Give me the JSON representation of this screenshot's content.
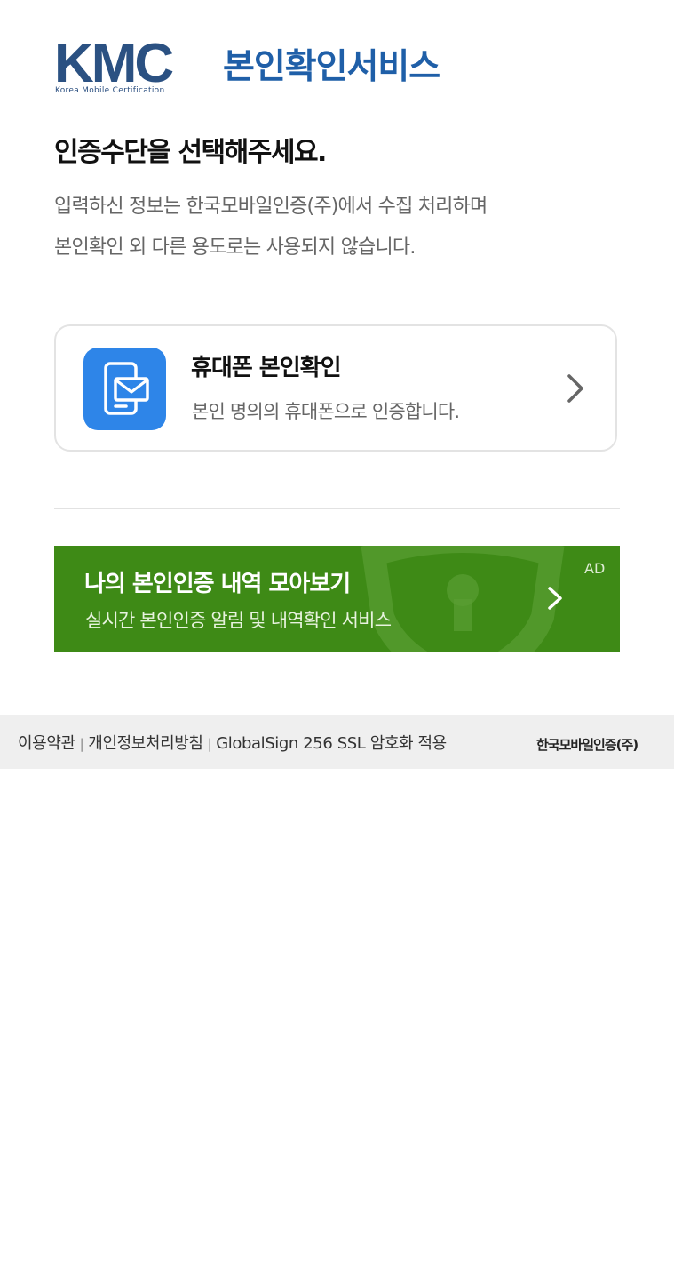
{
  "header": {
    "logo_text": "KMC",
    "logo_subtitle": "Korea Mobile Certification",
    "service_title": "본인확인서비스"
  },
  "intro": {
    "heading": "인증수단을 선택해주세요.",
    "description_lines": [
      "입력하신 정보는 한국모바일인증(주)에서 수집 처리하며",
      "본인확인 외 다른 용도로는 사용되지 않습니다."
    ]
  },
  "option": {
    "title": "휴대폰 본인확인",
    "description": "본인 명의의 휴대폰으로 인증합니다.",
    "icon": "phone-message-icon"
  },
  "ad": {
    "title": "나의 본인인증 내역 모아보기",
    "subtitle": "실시간 본인인증 알림 및 내역확인 서비스",
    "label": "AD"
  },
  "footer": {
    "links": [
      "이용약관",
      "개인정보처리방침",
      "GlobalSign 256 SSL 암호화 적용"
    ],
    "brand": "한국모바일인증(주)"
  },
  "colors": {
    "brand_blue": "#1f5fa8",
    "icon_blue": "#2e85e8",
    "ad_green": "#3e8a16",
    "footer_bg": "#efefef"
  }
}
